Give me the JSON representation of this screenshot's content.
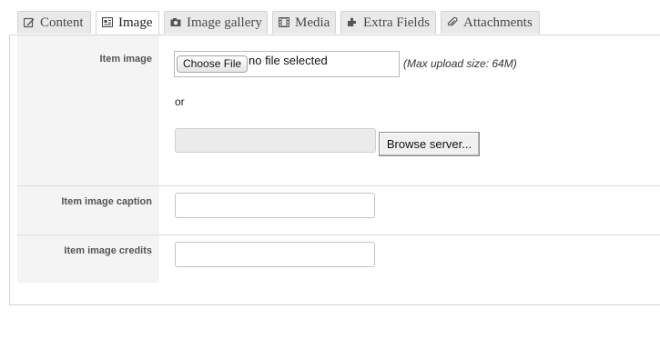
{
  "tabs": [
    {
      "label": "Content",
      "icon": "edit-icon",
      "active": false
    },
    {
      "label": "Image",
      "icon": "image-icon",
      "active": true
    },
    {
      "label": "Image gallery",
      "icon": "camera-icon",
      "active": false
    },
    {
      "label": "Media",
      "icon": "film-icon",
      "active": false
    },
    {
      "label": "Extra Fields",
      "icon": "puzzle-icon",
      "active": false
    },
    {
      "label": "Attachments",
      "icon": "paperclip-icon",
      "active": false
    }
  ],
  "form": {
    "item_image": {
      "label": "Item image",
      "choose_file_label": "Choose File",
      "file_status": "no file selected",
      "upload_hint": "(Max upload size: 64M)",
      "or_text": "or",
      "server_path_value": "",
      "browse_label": "Browse server..."
    },
    "caption": {
      "label": "Item image caption",
      "value": ""
    },
    "credits": {
      "label": "Item image credits",
      "value": ""
    }
  },
  "colors": {
    "tab_bg": "#e9e9e9",
    "label_bg": "#f4f4f4",
    "border": "#d4d4d4"
  }
}
